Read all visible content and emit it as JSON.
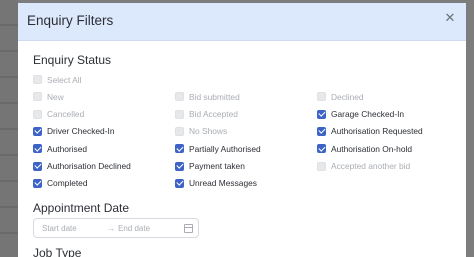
{
  "modal": {
    "title": "Enquiry Filters",
    "close_icon": "✕"
  },
  "enquiry_status": {
    "heading": "Enquiry Status",
    "options": [
      {
        "label": "Select All",
        "checked": false,
        "disabled": true
      },
      {
        "label": "New",
        "checked": false,
        "disabled": true
      },
      {
        "label": "Bid submitted",
        "checked": false,
        "disabled": true
      },
      {
        "label": "Declined",
        "checked": false,
        "disabled": true
      },
      {
        "label": "Cancelled",
        "checked": false,
        "disabled": true
      },
      {
        "label": "Bid Accepted",
        "checked": false,
        "disabled": true
      },
      {
        "label": "Garage Checked-In",
        "checked": true,
        "disabled": false
      },
      {
        "label": "Driver Checked-In",
        "checked": true,
        "disabled": false
      },
      {
        "label": "No Shows",
        "checked": false,
        "disabled": true
      },
      {
        "label": "Authorisation Requested",
        "checked": true,
        "disabled": false
      },
      {
        "label": "Authorised",
        "checked": true,
        "disabled": false
      },
      {
        "label": "Partially Authorised",
        "checked": true,
        "disabled": false
      },
      {
        "label": "Authorisation On-hold",
        "checked": true,
        "disabled": false
      },
      {
        "label": "Authorisation Declined",
        "checked": true,
        "disabled": false
      },
      {
        "label": "Payment taken",
        "checked": true,
        "disabled": false
      },
      {
        "label": "Accepted another bid",
        "checked": false,
        "disabled": true
      },
      {
        "label": "Completed",
        "checked": true,
        "disabled": false
      },
      {
        "label": "Unread Messages",
        "checked": true,
        "disabled": false
      }
    ]
  },
  "appointment_date": {
    "heading": "Appointment Date",
    "start_placeholder": "Start date",
    "separator": "→",
    "end_placeholder": "End date"
  },
  "job_type": {
    "heading": "Job Type"
  },
  "colors": {
    "header_bg": "#dce8fb",
    "checkbox_checked": "#3d63c8",
    "disabled_text": "#a9adb3"
  }
}
